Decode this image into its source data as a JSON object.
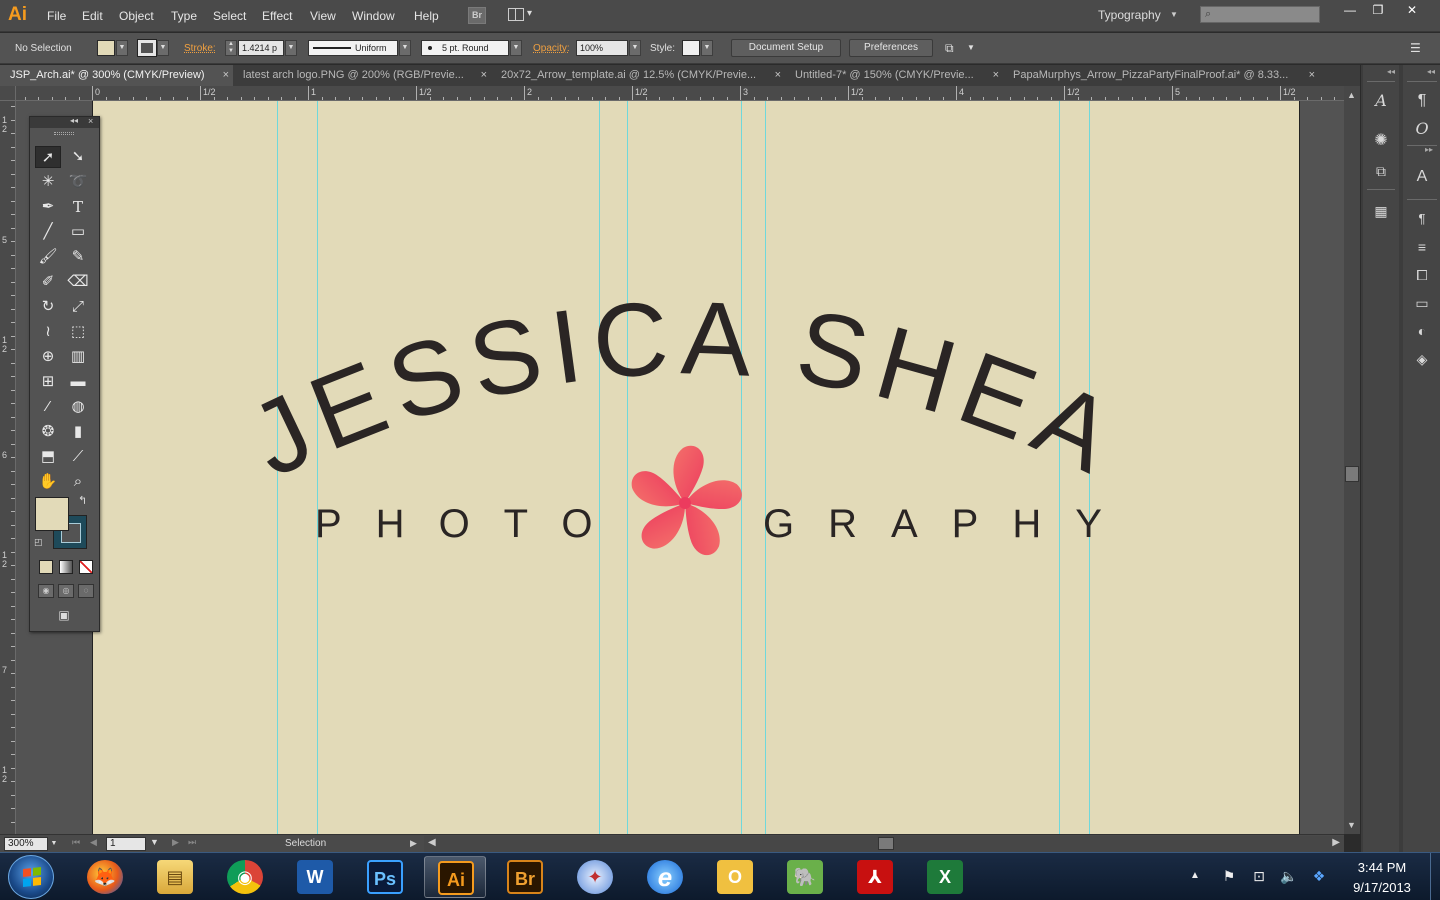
{
  "app": {
    "logo": "Ai"
  },
  "menu": [
    "File",
    "Edit",
    "Object",
    "Type",
    "Select",
    "Effect",
    "View",
    "Window",
    "Help"
  ],
  "menubar": {
    "bridge_label": "Br",
    "workspace": "Typography",
    "window_controls": {
      "minimize": "—",
      "restore": "❐",
      "close": "✕"
    }
  },
  "control_bar": {
    "selection_label": "No Selection",
    "stroke_label": "Stroke:",
    "stroke_weight": "1.4214 p",
    "variable_width_profile": "Uniform",
    "brush": "5 pt. Round",
    "opacity_label": "Opacity:",
    "opacity_value": "100%",
    "style_label": "Style:",
    "document_setup": "Document Setup",
    "preferences": "Preferences",
    "fill_color": "#e2dab8",
    "stroke_color": "#1e4a5a"
  },
  "tabs": [
    {
      "label": "JSP_Arch.ai* @ 300% (CMYK/Preview)",
      "active": true
    },
    {
      "label": "latest arch logo.PNG @ 200% (RGB/Previe...",
      "active": false
    },
    {
      "label": "20x72_Arrow_template.ai @ 12.5% (CMYK/Previe...",
      "active": false
    },
    {
      "label": "Untitled-7* @ 150% (CMYK/Previe...",
      "active": false
    },
    {
      "label": "PapaMurphys_Arrow_PizzaPartyFinalProof.ai* @ 8.33...",
      "active": false
    }
  ],
  "ruler_top": {
    "labels": [
      "0",
      "1/2",
      "1",
      "1/2",
      "2",
      "1/2",
      "3",
      "1/2",
      "4",
      "1/2",
      "5",
      "1/2"
    ]
  },
  "ruler_left": {
    "labels": [
      "1\n2",
      "5",
      "1\n2",
      "6",
      "1\n2",
      "7",
      "1\n2"
    ]
  },
  "artwork": {
    "title_text": "JESSICA SHEA",
    "subtitle_left": "PHOTO",
    "subtitle_right": "GRAPHY",
    "artboard_color": "#e2dab8",
    "text_color": "#2a2524",
    "flower_color_light": "#f4706a",
    "flower_color_dark": "#ec3b5e",
    "guide_color": "#5ad7e0"
  },
  "status_bar": {
    "zoom": "300%",
    "artboard_number": "1",
    "current_tool": "Selection"
  },
  "tools": {
    "icons": [
      [
        "selection-tool-icon",
        "direct-selection-tool-icon"
      ],
      [
        "magic-wand-tool-icon",
        "lasso-tool-icon"
      ],
      [
        "pen-tool-icon",
        "type-tool-icon"
      ],
      [
        "line-segment-tool-icon",
        "rectangle-tool-icon"
      ],
      [
        "paintbrush-tool-icon",
        "pencil-tool-icon"
      ],
      [
        "blob-brush-tool-icon",
        "eraser-tool-icon"
      ],
      [
        "rotate-tool-icon",
        "scale-tool-icon"
      ],
      [
        "warp-tool-icon",
        "free-transform-tool-icon"
      ],
      [
        "shape-builder-tool-icon",
        "perspective-grid-tool-icon"
      ],
      [
        "mesh-tool-icon",
        "gradient-tool-icon"
      ],
      [
        "eyedropper-tool-icon",
        "blend-tool-icon"
      ],
      [
        "symbol-sprayer-tool-icon",
        "column-graph-tool-icon"
      ],
      [
        "artboard-tool-icon",
        "slice-tool-icon"
      ],
      [
        "hand-tool-icon",
        "zoom-tool-icon"
      ]
    ],
    "type_glyph": "T"
  },
  "dock": {
    "left_col_icons": [
      "character-styles-icon",
      "symbols-icon",
      "transform-icon",
      "align-icon"
    ],
    "right_col_icons": [
      "paragraph-icon",
      "opentype-icon",
      "character-icon",
      "paragraph-styles-icon",
      "stroke-icon",
      "pathfinder-icon",
      "gradient-icon",
      "transparency-icon",
      "layers-icon"
    ]
  },
  "taskbar": {
    "apps": [
      {
        "name": "firefox",
        "label": ""
      },
      {
        "name": "file-explorer",
        "label": ""
      },
      {
        "name": "chrome",
        "label": ""
      },
      {
        "name": "word",
        "label": "W"
      },
      {
        "name": "photoshop",
        "label": "Ps"
      },
      {
        "name": "illustrator",
        "label": "Ai"
      },
      {
        "name": "bridge",
        "label": "Br"
      },
      {
        "name": "safari",
        "label": ""
      },
      {
        "name": "internet-explorer",
        "label": "e"
      },
      {
        "name": "outlook",
        "label": "O"
      },
      {
        "name": "evernote",
        "label": ""
      },
      {
        "name": "acrobat",
        "label": ""
      },
      {
        "name": "excel",
        "label": "X"
      }
    ],
    "time": "3:44 PM",
    "date": "9/17/2013"
  }
}
